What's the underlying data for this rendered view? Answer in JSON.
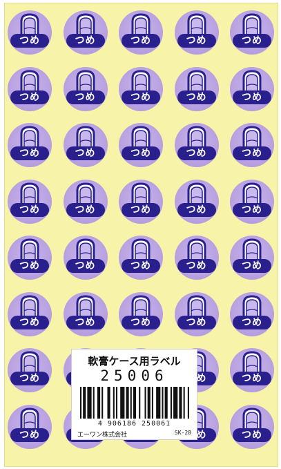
{
  "sticker": {
    "text": "つめ",
    "icon": "nail-icon",
    "colors": {
      "circle": "#b9a2e1",
      "pill": "#29208e",
      "text": "#ffffff",
      "sheet": "#f7f3a9"
    }
  },
  "grid": {
    "rows": 8,
    "cols": 5
  },
  "label": {
    "title": "軟膏ケース用ラベル",
    "code": "25006",
    "ean": "4 906186 250061",
    "maker": "エーワン株式会社",
    "model": "SK-28"
  }
}
